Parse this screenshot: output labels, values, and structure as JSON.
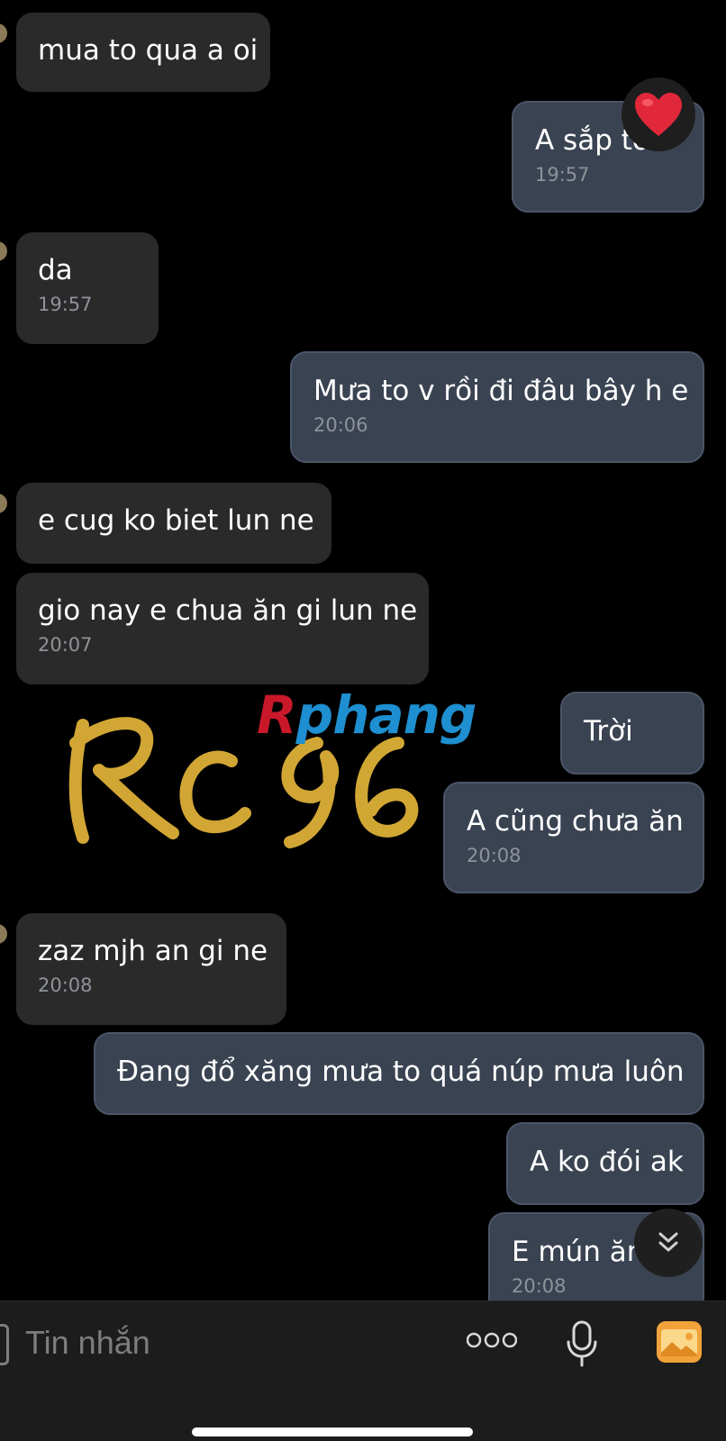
{
  "messages": [
    {
      "text": "mua to qua a oi",
      "time": ""
    },
    {
      "text": "A sắp tới",
      "time": "19:57"
    },
    {
      "text": "da",
      "time": "19:57"
    },
    {
      "text": "Mưa to v rồi đi đâu bây h e",
      "time": "20:06"
    },
    {
      "text": "e cug ko biet lun ne",
      "time": ""
    },
    {
      "text": "gio nay e chua ăn gi lun ne",
      "time": "20:07"
    },
    {
      "text": "Trời",
      "time": ""
    },
    {
      "text": "A cũng chưa ăn",
      "time": "20:08"
    },
    {
      "text": "zaz mjh an gi ne",
      "time": "20:08"
    },
    {
      "text": "Đang đổ  xăng mưa to quá núp mưa luôn",
      "time": ""
    },
    {
      "text": "A ko đói ak",
      "time": ""
    },
    {
      "text": "E mún ăn",
      "time": "20:08"
    }
  ],
  "reaction": {
    "icon": "heart-icon",
    "color": "#e0283a"
  },
  "watermark": {
    "brand": "Rphang",
    "brand_first": "R",
    "brand_rest": "phang",
    "tag": "RC96"
  },
  "composer": {
    "placeholder": "Tin nhắn",
    "icons": [
      "more-icon",
      "microphone-icon",
      "photo-gallery-icon"
    ]
  },
  "colors": {
    "incoming": "#2a2a2a",
    "outgoing": "#3a4352",
    "accent": "#f2a23a"
  }
}
